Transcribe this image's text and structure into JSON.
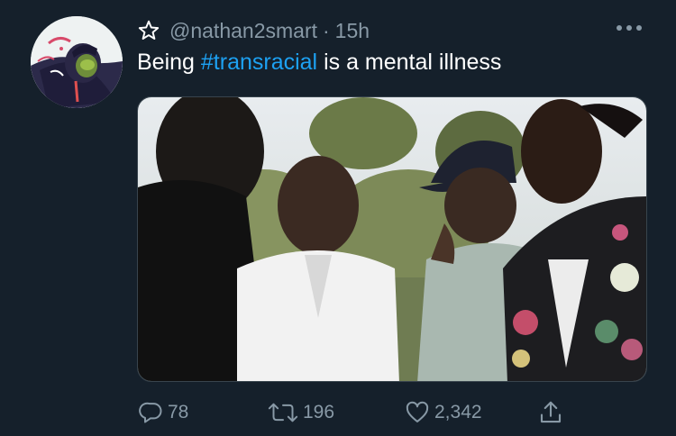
{
  "tweet": {
    "username": "@nathan2smart",
    "separator": "·",
    "time": "15h",
    "text_before": "Being ",
    "hashtag": "#transracial",
    "text_after": " is a mental illness",
    "star_icon": "star-outline-icon",
    "more_icon": "more-dots-icon"
  },
  "actions": {
    "replies": "78",
    "retweets": "196",
    "likes": "2,342",
    "reply_icon": "comment-icon",
    "retweet_icon": "retweet-icon",
    "like_icon": "heart-icon",
    "share_icon": "share-icon"
  },
  "colors": {
    "background": "#15202b",
    "text": "#ffffff",
    "muted": "#8899a6",
    "link": "#1da1f2",
    "border": "#38444d"
  }
}
